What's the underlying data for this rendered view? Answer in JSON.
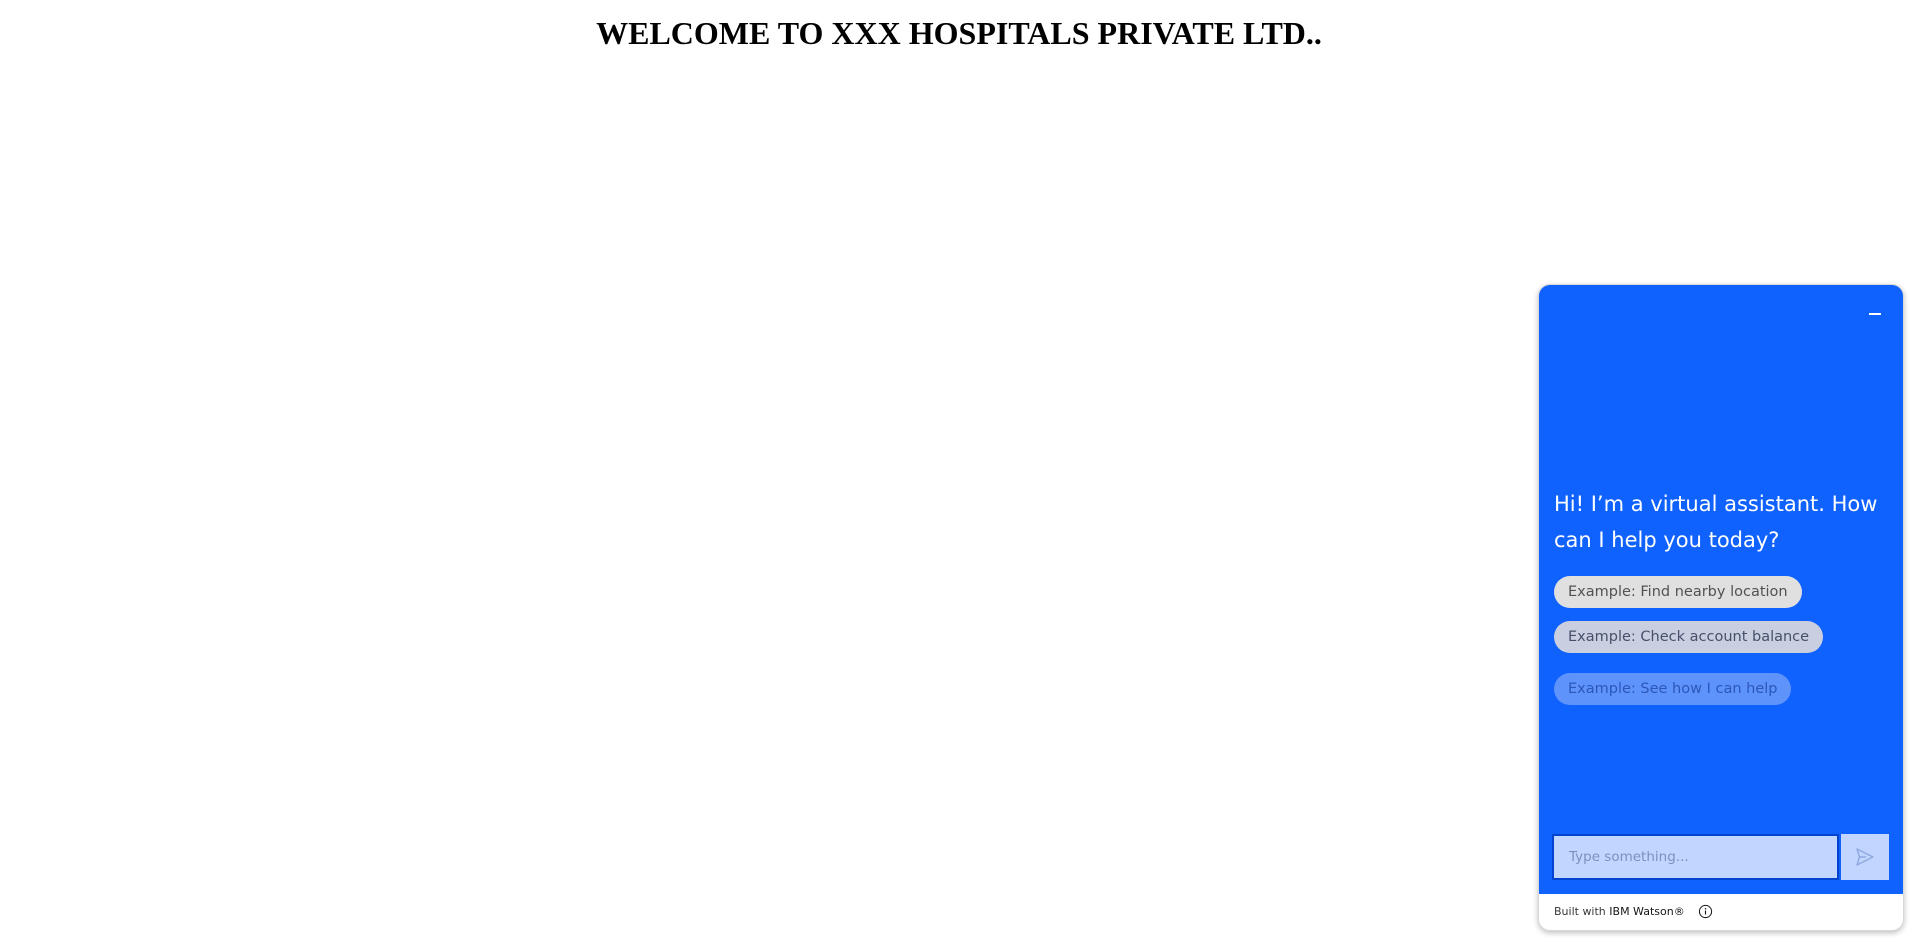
{
  "page": {
    "title": "WELCOME TO XXX HOSPITALS PRIVATE LTD.."
  },
  "chat": {
    "accent_color": "#0f62fe",
    "minimize_icon": "minimize-icon",
    "greeting": "Hi! I’m a virtual assistant. How can I help you today?",
    "suggestions": [
      "Example: Find nearby location",
      "Example: Check account balance",
      "Example: See how I can help"
    ],
    "input": {
      "placeholder": "Type something...",
      "value": ""
    },
    "send_icon": "send-icon",
    "footer": {
      "prefix": "Built with ",
      "brand": "IBM Watson®",
      "info_icon": "info-icon"
    }
  }
}
